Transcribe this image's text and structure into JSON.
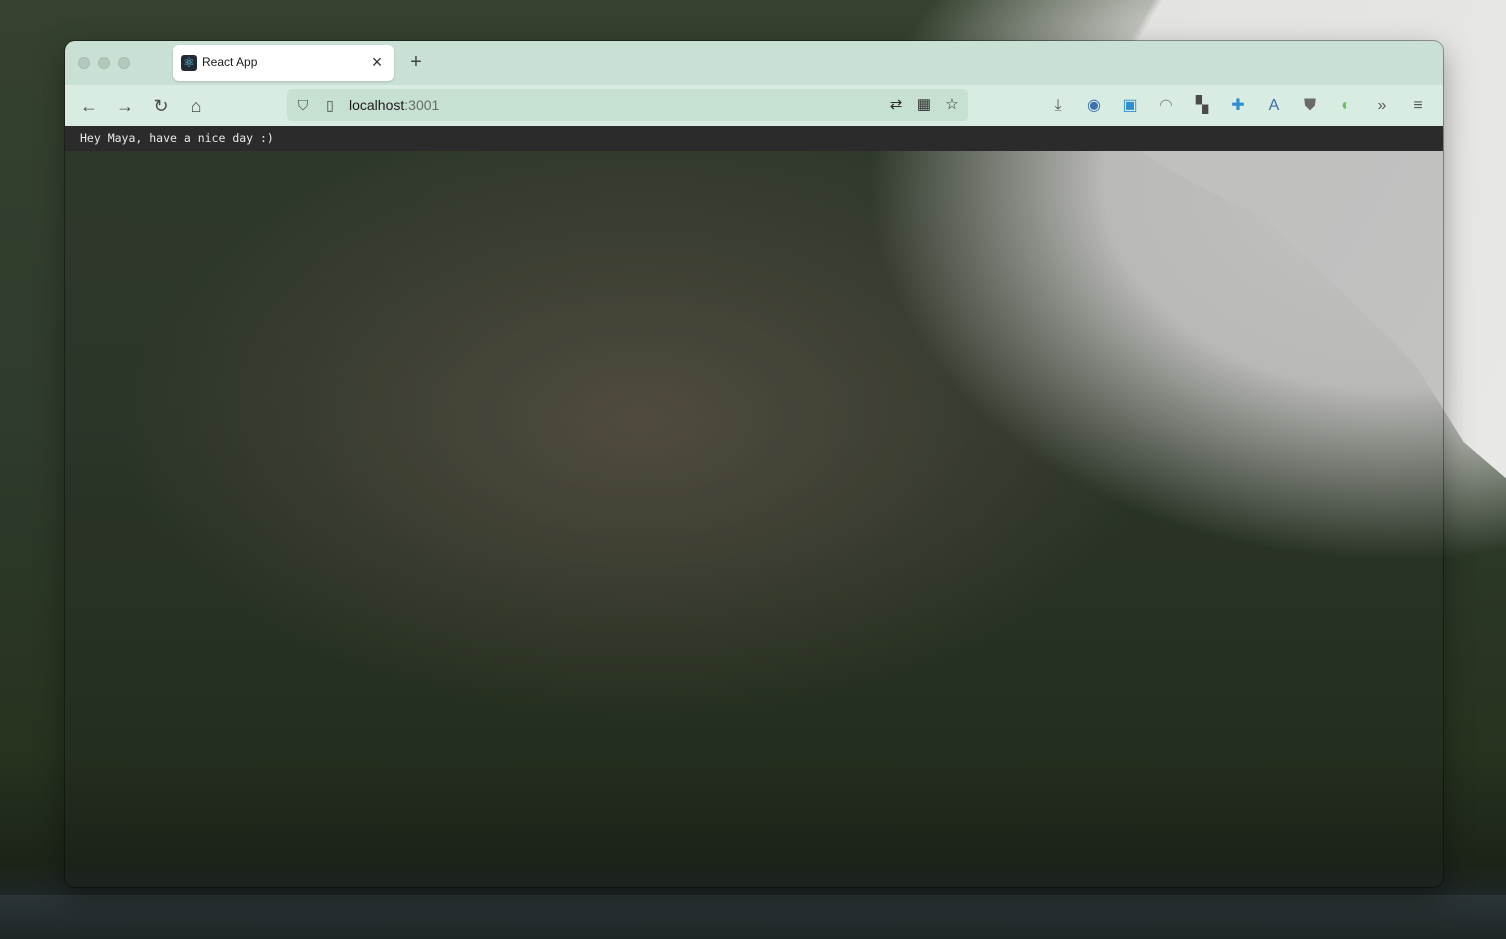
{
  "browser": {
    "tab": {
      "title": "React App",
      "favicon": "react-logo-icon"
    },
    "address_bar": {
      "host": "localhost",
      "port": ":3001"
    }
  },
  "toolbar_icons": [
    "download-icon",
    "password-manager-icon",
    "save-icon",
    "extension-arc-icon",
    "extensions-grid-icon",
    "bookmark-plus-icon",
    "translate-icon",
    "shield-extension-icon",
    "toggle-extension-icon",
    "overflow-chevrons-icon",
    "hamburger-menu-icon"
  ],
  "page": {
    "banner_text": "Hey Maya, have a nice day :)"
  },
  "colors": {
    "tabbar": "#c8e1d4",
    "navbar": "#d9ece2",
    "urlbar": "#c6e0d2",
    "banner": "#2b2b2b"
  }
}
